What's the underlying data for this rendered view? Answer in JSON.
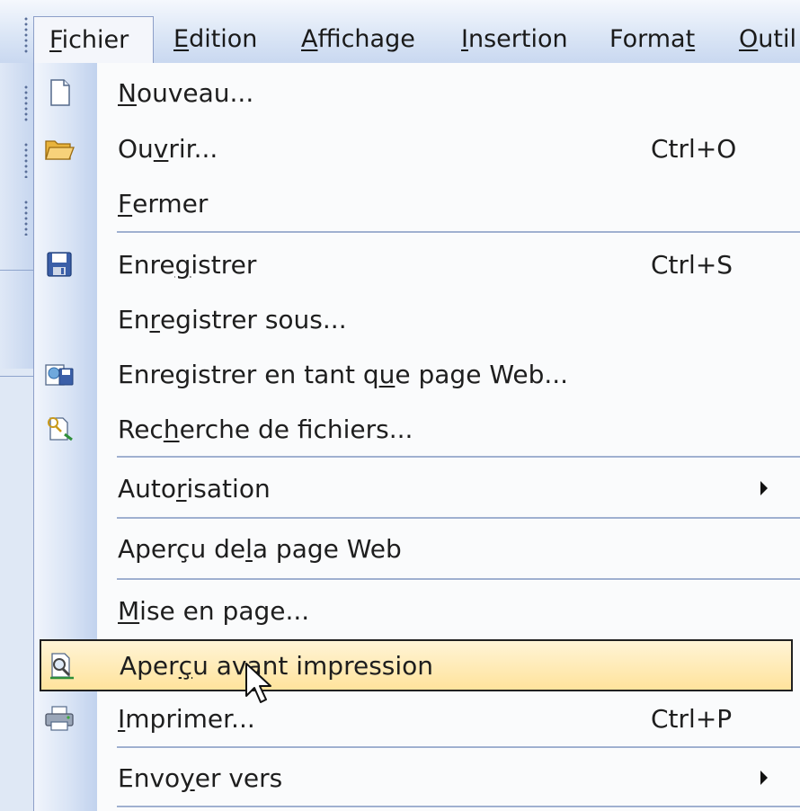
{
  "menubar": {
    "menus": [
      {
        "before": "",
        "key": "F",
        "after": "ichier"
      },
      {
        "before": "",
        "key": "E",
        "after": "dition"
      },
      {
        "before": "",
        "key": "A",
        "after": "ffichage"
      },
      {
        "before": "",
        "key": "I",
        "after": "nsertion"
      },
      {
        "before": "Forma",
        "key": "t",
        "after": ""
      },
      {
        "before": "",
        "key": "O",
        "after": "util"
      }
    ]
  },
  "dropdown": {
    "items": [
      {
        "icon": "new-document-icon",
        "before": "",
        "key": "N",
        "after": "ouveau...",
        "shortcut": ""
      },
      {
        "icon": "open-folder-icon",
        "before": "Ou",
        "key": "v",
        "after": "rir...",
        "shortcut": "Ctrl+O"
      },
      {
        "icon": "",
        "before": "",
        "key": "F",
        "after": "ermer",
        "shortcut": ""
      },
      {
        "icon": "save-disk-icon",
        "before": "Enre",
        "key": "g",
        "after": "istrer",
        "shortcut": "Ctrl+S"
      },
      {
        "icon": "",
        "before": "En",
        "key": "r",
        "after": "egistrer sous...",
        "shortcut": ""
      },
      {
        "icon": "save-as-web-page-icon",
        "before": "Enregistrer en tant q",
        "key": "u",
        "after": "e page Web...",
        "shortcut": ""
      },
      {
        "icon": "file-search-icon",
        "before": "Rec",
        "key": "h",
        "after": "erche de fichiers...",
        "shortcut": ""
      },
      {
        "icon": "",
        "before": "Auto",
        "key": "r",
        "after": "isation",
        "shortcut": ""
      },
      {
        "icon": "",
        "before": "Aperçu de ",
        "key": "l",
        "after": "a page Web",
        "shortcut": ""
      },
      {
        "icon": "",
        "before": "",
        "key": "M",
        "after": "ise en page...",
        "shortcut": ""
      },
      {
        "icon": "print-preview-icon",
        "before": "Aper",
        "key": "ç",
        "after": "u avant impression",
        "shortcut": ""
      },
      {
        "icon": "printer-icon",
        "before": "",
        "key": "I",
        "after": "mprimer...",
        "shortcut": "Ctrl+P"
      },
      {
        "icon": "",
        "before": "Envo",
        "key": "y",
        "after": "er vers",
        "shortcut": ""
      }
    ]
  },
  "colors": {
    "highlight_top": "#fff4d6",
    "highlight_bottom": "#ffe39c",
    "menubar_blue": "#c9d8f0"
  }
}
